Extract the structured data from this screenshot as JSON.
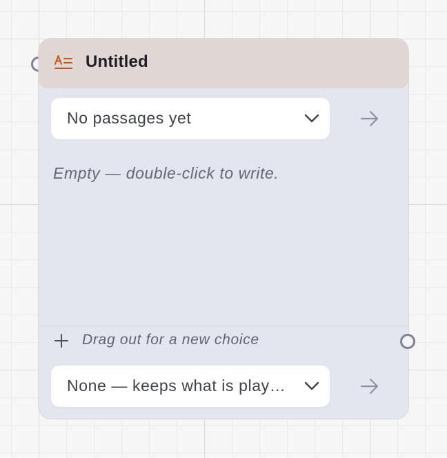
{
  "node": {
    "title": "Untitled",
    "passage_select": {
      "value": "No passages yet"
    },
    "body_placeholder": "Empty — double-click to write.",
    "choice_hint": "Drag out for a new choice",
    "audio_select": {
      "value": "None — keeps what is play…"
    },
    "icons": {
      "header": "passage-text-icon",
      "dropdown": "chevron-down-icon",
      "navigate": "arrow-right-icon",
      "add": "plus-icon"
    },
    "colors": {
      "header_bg": "#e0d6d4",
      "node_bg": "#e3e6ee",
      "icon_accent": "#c2571a",
      "port": "#7c8194"
    }
  }
}
